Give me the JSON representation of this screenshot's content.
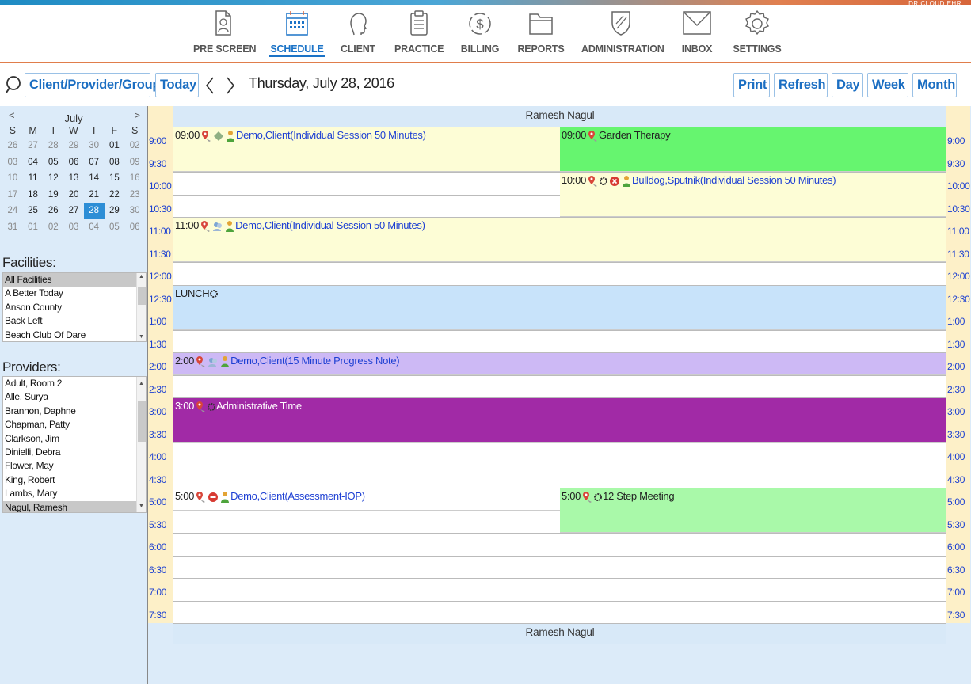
{
  "brand": "DR CLOUD EHR",
  "nav": [
    {
      "label": "PRE SCREEN",
      "icon": "prescreen-icon"
    },
    {
      "label": "SCHEDULE",
      "icon": "calendar-icon",
      "active": true
    },
    {
      "label": "CLIENT",
      "icon": "client-head-icon"
    },
    {
      "label": "PRACTICE",
      "icon": "clipboard-icon"
    },
    {
      "label": "BILLING",
      "icon": "dollar-icon"
    },
    {
      "label": "REPORTS",
      "icon": "folder-icon"
    },
    {
      "label": "ADMINISTRATION",
      "icon": "shield-icon"
    },
    {
      "label": "INBOX",
      "icon": "envelope-icon"
    },
    {
      "label": "SETTINGS",
      "icon": "gear-icon"
    }
  ],
  "toolbar": {
    "client_provider_group": "Client/Provider/Group",
    "today": "Today",
    "date": "Thursday, July 28, 2016",
    "print": "Print",
    "refresh": "Refresh",
    "day": "Day",
    "week": "Week",
    "month": "Month"
  },
  "mini_calendar": {
    "month": "July",
    "prev": "<",
    "next": ">",
    "weekdays": [
      "S",
      "M",
      "T",
      "W",
      "T",
      "F",
      "S"
    ],
    "weeks": [
      [
        "26",
        "27",
        "28",
        "29",
        "30",
        "01",
        "02"
      ],
      [
        "03",
        "04",
        "05",
        "06",
        "07",
        "08",
        "09"
      ],
      [
        "10",
        "11",
        "12",
        "13",
        "14",
        "15",
        "16"
      ],
      [
        "17",
        "18",
        "19",
        "20",
        "21",
        "22",
        "23"
      ],
      [
        "24",
        "25",
        "26",
        "27",
        "28",
        "29",
        "30"
      ],
      [
        "31",
        "01",
        "02",
        "03",
        "04",
        "05",
        "06"
      ]
    ],
    "selected": "28"
  },
  "facilities": {
    "title": "Facilities:",
    "items": [
      "All Facilities",
      "A Better Today",
      "Anson County",
      "Back Left",
      "Beach Club Of Dare"
    ],
    "selected": "All Facilities"
  },
  "providers": {
    "title": "Providers:",
    "items": [
      "Adult, Room 2",
      "Alle, Surya",
      "Brannon, Daphne",
      "Chapman, Patty",
      "Clarkson, Jim",
      "Dinielli, Debra",
      "Flower, May",
      "King, Robert",
      "Lambs, Mary",
      "Nagul, Ramesh"
    ],
    "selected": "Nagul, Ramesh"
  },
  "schedule": {
    "provider": "Ramesh Nagul",
    "times": [
      "9:00",
      "9:30",
      "10:00",
      "10:30",
      "11:00",
      "11:30",
      "12:00",
      "12:30",
      "1:00",
      "1:30",
      "2:00",
      "2:30",
      "3:00",
      "3:30",
      "4:00",
      "4:30",
      "5:00",
      "5:30",
      "6:00",
      "6:30",
      "7:00",
      "7:30"
    ],
    "appointments": [
      {
        "time": "09:00",
        "text": "Demo,Client(Individual Session 50 Minutes)",
        "color": "#fdfdd6"
      },
      {
        "time": "09:00",
        "text": "Garden Therapy",
        "color": "#66f56f"
      },
      {
        "time": "10:00",
        "text": "Bulldog,Sputnik(Individual Session 50 Minutes)",
        "color": "#fdfdd6"
      },
      {
        "time": "11:00",
        "text": "Demo,Client(Individual Session 50 Minutes)",
        "color": "#fdfdd6"
      },
      {
        "time": "",
        "text": "LUNCH",
        "color": "#c8e3fa"
      },
      {
        "time": "2:00",
        "text": "Demo,Client(15 Minute Progress Note)",
        "color": "#cdb9f5"
      },
      {
        "time": "3:00",
        "text": "Administrative Time",
        "color": "#a12aa6"
      },
      {
        "time": "5:00",
        "text": "Demo,Client(Assessment-IOP)",
        "color": "#ffffff"
      },
      {
        "time": "5:00",
        "text": "12 Step Meeting",
        "color": "#a9f9a9"
      }
    ]
  }
}
